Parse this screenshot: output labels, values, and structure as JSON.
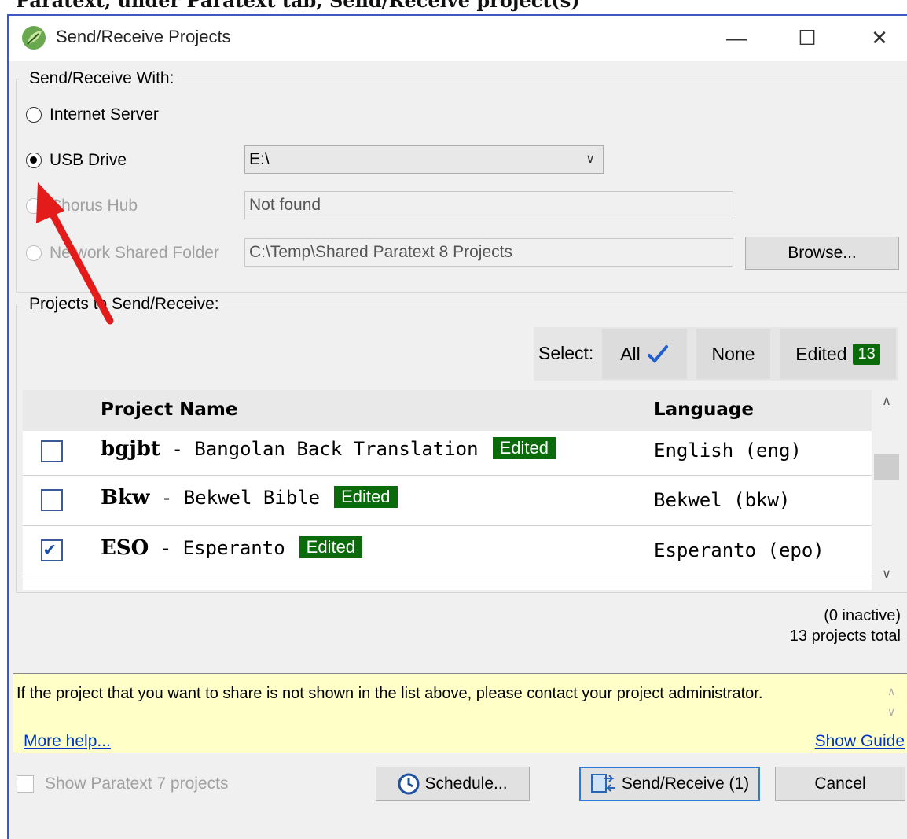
{
  "caption": "Paratext, under Paratext tab, Send/Receive project(s)",
  "window": {
    "title": "Send/Receive Projects",
    "minimize_glyph": "—",
    "maximize_glyph": "☐",
    "close_glyph": "✕"
  },
  "send_receive_with": {
    "label": "Send/Receive With:",
    "options": [
      {
        "label": "Internet Server",
        "selected": false,
        "enabled": true
      },
      {
        "label": "USB Drive",
        "selected": true,
        "enabled": true,
        "value": "E:\\"
      },
      {
        "label": "Chorus Hub",
        "selected": false,
        "enabled": false,
        "value": "Not found"
      },
      {
        "label": "Network Shared Folder",
        "selected": false,
        "enabled": false,
        "value": "C:\\Temp\\Shared Paratext 8 Projects"
      }
    ],
    "browse_label": "Browse..."
  },
  "projects": {
    "label": "Projects to Send/Receive:",
    "select_label": "Select:",
    "select_all": "All",
    "select_none": "None",
    "select_edited": "Edited",
    "edited_count": "13",
    "columns": {
      "name": "Project Name",
      "language": "Language"
    },
    "rows": [
      {
        "code": "bgjbt",
        "sep": " - ",
        "name": "Bangolan Back Translation",
        "badge": "Edited",
        "language": "English (eng)",
        "checked": false
      },
      {
        "code": "Bkw",
        "sep": " - ",
        "name": "Bekwel Bible",
        "badge": "Edited",
        "language": "Bekwel (bkw)",
        "checked": false
      },
      {
        "code": "ESO",
        "sep": " - ",
        "name": "Esperanto",
        "badge": "Edited",
        "language": "Esperanto (epo)",
        "checked": true
      }
    ],
    "inactive": "(0 inactive)",
    "total": "13 projects total"
  },
  "help": {
    "message": "If the project that you want to share is not shown in the list above, please contact your project administrator.",
    "more_help": "More help...",
    "show_guide": "Show Guide"
  },
  "footer": {
    "show_pt7": "Show Paratext 7 projects",
    "schedule": "Schedule...",
    "send_receive": "Send/Receive (1)",
    "cancel": "Cancel"
  },
  "colors": {
    "accent_green": "#0b6b0b",
    "window_border": "#3d57c4",
    "annotation_arrow": "#e31b1b"
  },
  "icons": {
    "app": "paratext-leaf-icon",
    "schedule": "clock-icon",
    "send_receive": "sync-icon"
  }
}
